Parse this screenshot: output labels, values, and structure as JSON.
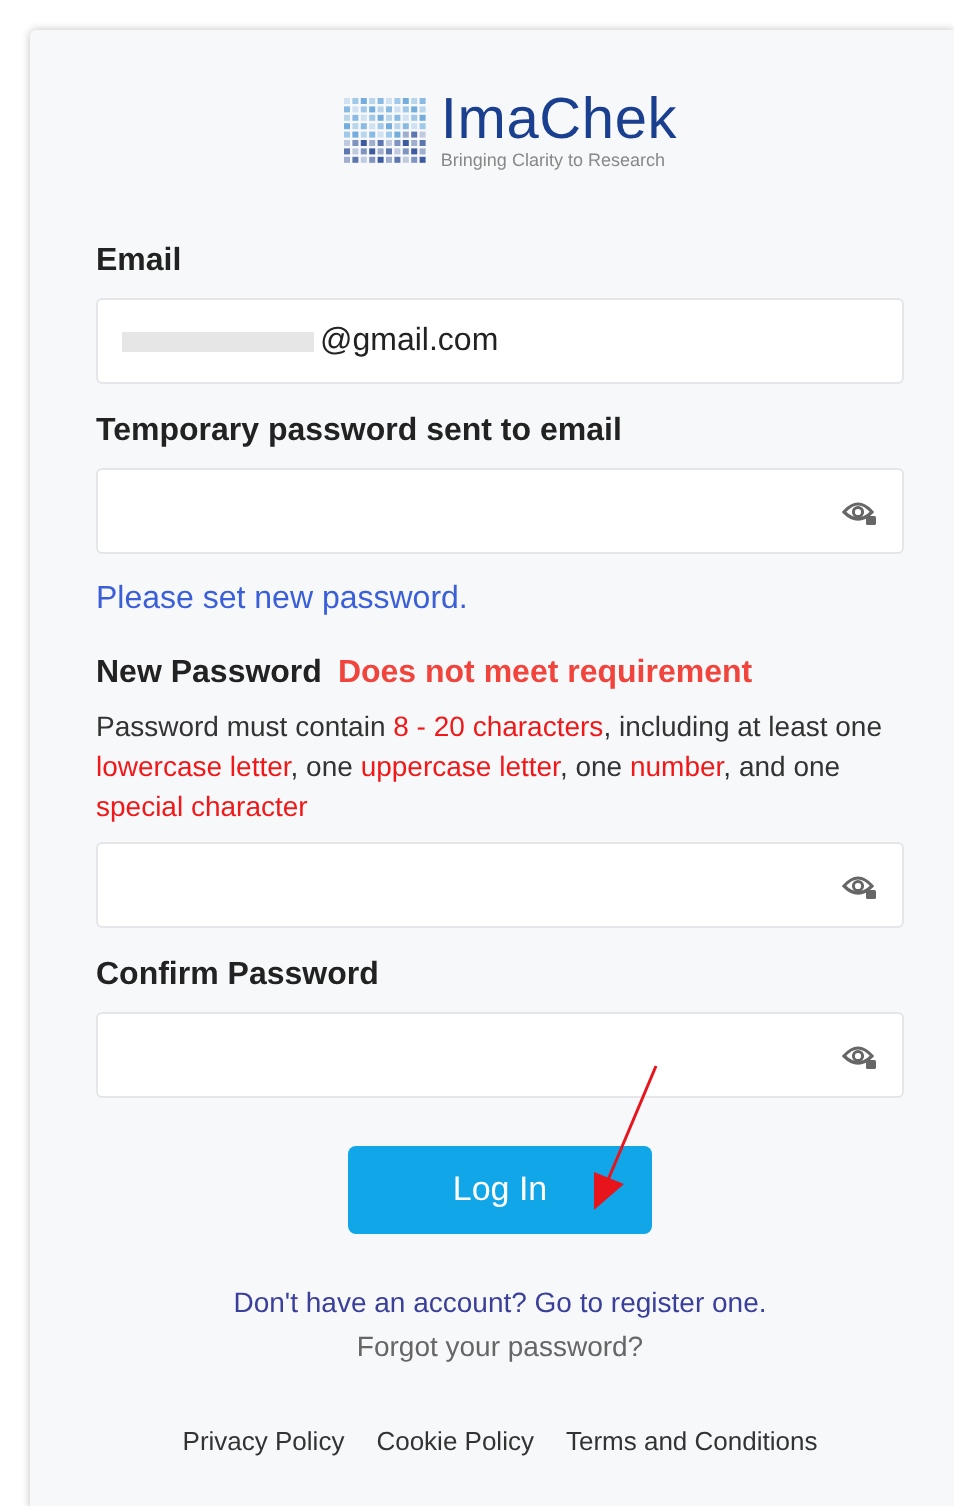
{
  "logo": {
    "name": "ImaChek",
    "tagline": "Bringing Clarity to Research"
  },
  "email": {
    "label": "Email",
    "value": "@gmail.com",
    "redacted": true
  },
  "temp_password": {
    "label": "Temporary password sent to email"
  },
  "notice": "Please set new password.",
  "new_password": {
    "label": "New Password",
    "error": "Does not meet requirement",
    "rule": [
      {
        "kind": "plain",
        "text": "Password must contain "
      },
      {
        "kind": "highlight",
        "text": "8 - 20 characters"
      },
      {
        "kind": "plain",
        "text": ", including at least one "
      },
      {
        "kind": "highlight",
        "text": "lowercase letter"
      },
      {
        "kind": "plain",
        "text": ", one "
      },
      {
        "kind": "highlight",
        "text": "uppercase letter"
      },
      {
        "kind": "plain",
        "text": ", one "
      },
      {
        "kind": "highlight",
        "text": "number"
      },
      {
        "kind": "plain",
        "text": ", and one "
      },
      {
        "kind": "highlight",
        "text": "special character"
      }
    ]
  },
  "confirm_password": {
    "label": "Confirm Password"
  },
  "login_button": "Log In",
  "register_link": "Don't have an account? Go to register one.",
  "forgot_link": "Forgot your password?",
  "footer_links": [
    "Privacy Policy",
    "Cookie Policy",
    "Terms and Conditions"
  ]
}
